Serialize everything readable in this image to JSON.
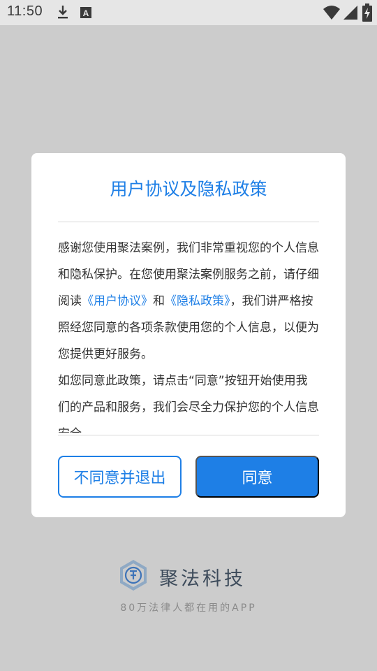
{
  "status_bar": {
    "time": "11:50",
    "icons": [
      "download-icon",
      "accessibility-a-icon",
      "wifi-icon",
      "signal-icon",
      "battery-charging-icon"
    ]
  },
  "dialog": {
    "title": "用户协议及隐私政策",
    "body": {
      "p1_pre": "感谢您使用聚法案例，我们非常重视您的个人信息和隐私保护。在您使用聚法案例服务之前，请仔细阅读",
      "link_user_agreement": "《用户协议》",
      "p1_mid": "和",
      "link_privacy_policy": "《隐私政策》",
      "p1_post": "，我们讲严格按照经您同意的各项条款使用您的个人信息，以便为您提供更好服务。",
      "p2": "如您同意此政策，请点击“同意”按钮开始使用我们的产品和服务，我们会尽全力保护您的个人信息安全。"
    },
    "decline_label": "不同意并退出",
    "agree_label": "同意"
  },
  "brand": {
    "name": "聚法科技",
    "slogan": "80万法律人都在用的APP"
  },
  "colors": {
    "accent": "#1e7fe6",
    "overlay": "#cccccc",
    "dialog_bg": "#ffffff"
  }
}
